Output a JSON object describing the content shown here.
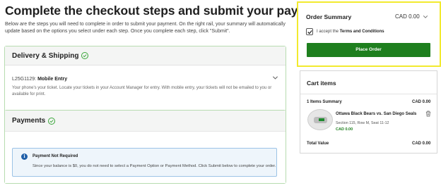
{
  "header": {
    "title": "Complete the checkout steps and submit your payment",
    "intro": "Below are the steps you will need to complete in order to submit your payment. On the right rail, your summary will automatically update based on the options you select under each step. Once you complete each step, click \"Submit\"."
  },
  "delivery": {
    "title": "Delivery & Shipping",
    "code": "L25G1129:",
    "mode": "Mobile Entry",
    "description": "Your phone's your ticket. Locate your tickets in your Account Manager for entry. With mobile entry, your tickets will not be emailed to you or available for print."
  },
  "payments": {
    "title": "Payments",
    "notice_title": "Payment Not Required",
    "notice_text": "Since your balance is $0, you do not need to select a Payment Option or Payment Method. Click Submit below to complete your order."
  },
  "order_summary": {
    "title": "Order Summary",
    "amount": "CAD 0.00",
    "terms_prefix": "I accept the",
    "terms_link": "Terms and Conditions",
    "terms_checked": true,
    "place_order_label": "Place Order"
  },
  "cart": {
    "title": "Cart items",
    "items_summary": "1 Items Summary",
    "items_amount": "CAD 0.00",
    "event_name": "Ottawa Black Bears vs. San Diego Seals",
    "seat_info": "Section 115, Row M, Seat 11-12",
    "event_price": "CAD 0.00",
    "total_label": "Total Value",
    "total_amount": "CAD 0.00"
  },
  "colors": {
    "accent_green": "#1e7f1e",
    "panel_border": "#b7dcb0",
    "highlight_yellow": "#f2ea2e",
    "notice_blue": "#1f5fa8"
  },
  "icons": [
    "check-circle-icon",
    "chevron-down-icon",
    "info-icon",
    "checkbox-checked-icon",
    "trash-icon",
    "seat-map-icon"
  ]
}
